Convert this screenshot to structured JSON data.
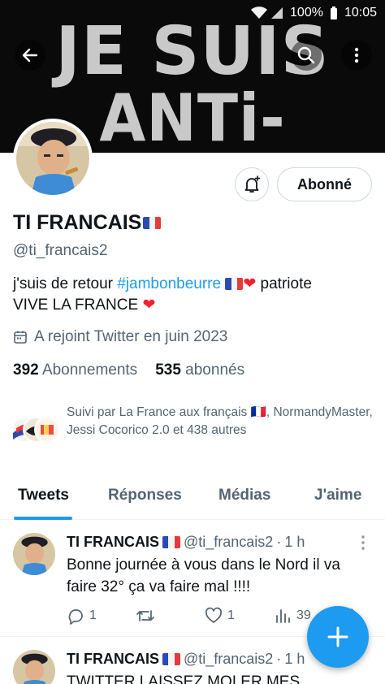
{
  "status_bar": {
    "battery": "100%",
    "time": "10:05"
  },
  "banner": {
    "line1": "JE SUIS",
    "line2": "ANTi-WOKE"
  },
  "profile": {
    "name": "TI FRANCAIS",
    "handle": "@ti_francais2",
    "bio_prefix": "j'suis de retour ",
    "bio_hashtag": "#jambonbeurre",
    "bio_suffix": " patriote",
    "bio_line2": "VIVE LA FRANCE ",
    "joined": "A rejoint Twitter en juin 2023",
    "following_count": "392",
    "following_label": "Abonnements",
    "followers_count": "535",
    "followers_label": "abonnés",
    "follow_button": "Abonné",
    "followed_by": "Suivi par La France aux français 🇫🇷, NormandyMaster, Jessi Cocorico 2.0 et 438 autres"
  },
  "tabs": [
    {
      "label": "Tweets",
      "active": true
    },
    {
      "label": "Réponses",
      "active": false
    },
    {
      "label": "Médias",
      "active": false
    },
    {
      "label": "J'aime",
      "active": false
    }
  ],
  "tweets": [
    {
      "name": "TI FRANCAIS",
      "handle": "@ti_francais2",
      "sep": "·",
      "time": "1 h",
      "text": "Bonne journée à vous  dans le Nord il va faire 32° ça va faire mal !!!!",
      "replies": "1",
      "retweets": "",
      "likes": "1",
      "views": "39"
    },
    {
      "name": "TI FRANCAIS",
      "handle": "@ti_francais2",
      "sep": "·",
      "time": "1 h",
      "text": "TWITTER LAISSEZ MOI ER MES"
    }
  ],
  "colors": {
    "accent": "#1d9bf0",
    "text_primary": "#0f1419",
    "text_secondary": "#536471",
    "heart": "#f4212e",
    "banner_bg": "#0a0a0a"
  },
  "icons": {
    "back": "arrow-left-icon",
    "search": "search-icon",
    "more": "more-vertical-icon",
    "bell": "bell-plus-icon",
    "calendar": "calendar-icon",
    "reply": "reply-icon",
    "retweet": "retweet-icon",
    "like": "heart-icon",
    "views": "views-icon",
    "share": "share-icon",
    "compose": "plus-icon"
  }
}
